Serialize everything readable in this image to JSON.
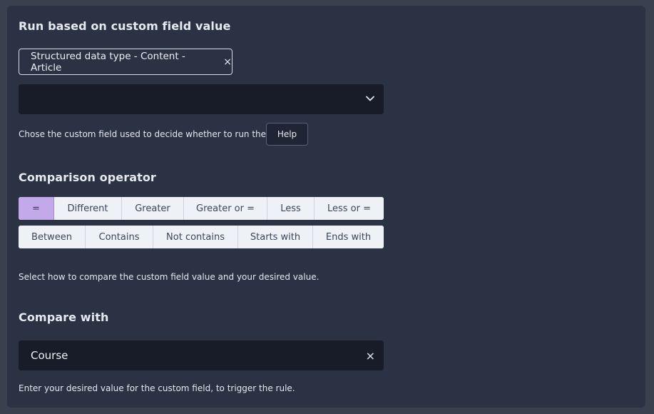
{
  "section1": {
    "heading": "Run based on custom field value",
    "chip_label": "Structured data type - Content - Article",
    "chip_close_icon": "×",
    "select_value": "",
    "help_text": "Chose the custom field used to decide whether to run the rule.",
    "help_button": "Help"
  },
  "section2": {
    "heading": "Comparison operator",
    "row1": [
      "=",
      "Different",
      "Greater",
      "Greater or =",
      "Less",
      "Less or ="
    ],
    "row2": [
      "Between",
      "Contains",
      "Not contains",
      "Starts with",
      "Ends with"
    ],
    "selected": "=",
    "help_text": "Select how to compare the custom field value and your desired value."
  },
  "section3": {
    "heading": "Compare with",
    "value": "Course",
    "clear_icon": "×",
    "help_text": "Enter your desired value for the custom field, to trigger the rule."
  },
  "colors": {
    "panel_bg": "#2b3244",
    "input_bg": "#171c28",
    "active_operator": "#c4a9ea",
    "operator_bg": "#eef2f6"
  }
}
